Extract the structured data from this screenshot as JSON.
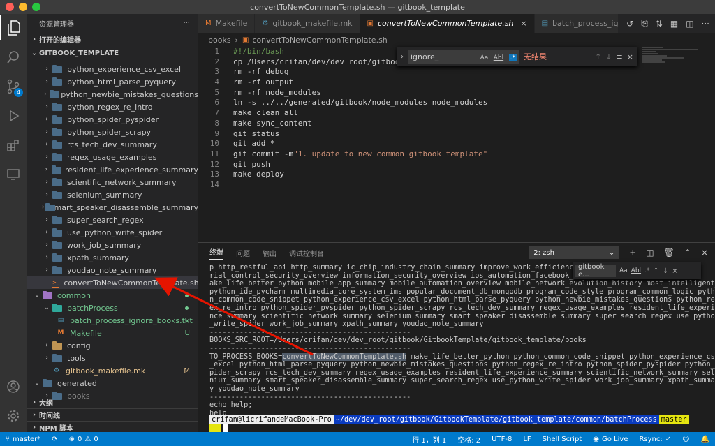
{
  "window": {
    "title": "convertToNewCommonTemplate.sh — gitbook_template"
  },
  "activity_bar": {
    "scm_badge": "4"
  },
  "sidebar": {
    "header": "资源管理器",
    "more": "···",
    "open_editors": "打开的编辑器",
    "workspace": "GITBOOK_TEMPLATE",
    "items": [
      {
        "label": "python_experience_csv_excel"
      },
      {
        "label": "python_html_parse_pyquery"
      },
      {
        "label": "python_newbie_mistakes_questions"
      },
      {
        "label": "python_regex_re_intro"
      },
      {
        "label": "python_spider_pyspider"
      },
      {
        "label": "python_spider_scrapy"
      },
      {
        "label": "rcs_tech_dev_summary"
      },
      {
        "label": "regex_usage_examples"
      },
      {
        "label": "resident_life_experience_summary"
      },
      {
        "label": "scientific_network_summary"
      },
      {
        "label": "selenium_summary"
      },
      {
        "label": "smart_speaker_disassemble_summary"
      },
      {
        "label": "super_search_regex"
      },
      {
        "label": "use_python_write_spider"
      },
      {
        "label": "work_job_summary"
      },
      {
        "label": "xpath_summary"
      },
      {
        "label": "youdao_note_summary"
      }
    ],
    "selected_file": "convertToNewCommonTemplate.sh",
    "common": "common",
    "batchProcess": "batchProcess",
    "batch_file": "batch_process_ignore_books.txt",
    "batch_status": "U",
    "makefile": "Makefile",
    "makefile_status": "U",
    "config": "config",
    "tools": "tools",
    "gitbook_makefile": "gitbook_makefile.mk",
    "gitbook_makefile_status": "M",
    "generated": "generated",
    "books": "books",
    "outline": "大纲",
    "timeline": "时间线",
    "npm": "NPM 脚本"
  },
  "tabs": [
    {
      "label": "Makefile",
      "icon": "makefile-icon",
      "color": "#e37933"
    },
    {
      "label": "gitbook_makefile.mk",
      "icon": "gear-icon",
      "color": "#519aba"
    },
    {
      "label": "convertToNewCommonTemplate.sh",
      "icon": "terminal-icon",
      "color": "#e37933",
      "active": true
    },
    {
      "label": "batch_process_ignc",
      "icon": "file-icon",
      "color": "#519aba"
    }
  ],
  "breadcrumb": {
    "folder": "books",
    "file": "convertToNewCommonTemplate.sh"
  },
  "code_lines": [
    "#!/bin/bash",
    "cp /Users/crifan/dev/dev_root/gitbook/g",
    "rm -rf debug",
    "rm -rf output",
    "rm -rf node_modules",
    "ln -s ../../generated/gitbook/node_modules node_modules",
    "make clean_all",
    "make sync_content",
    "git status",
    "git add *",
    "git commit -m ",
    "git push",
    "make deploy",
    ""
  ],
  "commit_message": "\"1. update to new common gitbook template\"",
  "find": {
    "value": "ignore_",
    "opt_case": "Aa",
    "opt_word": "Abl",
    "opt_regex": ".*",
    "result": "无结果"
  },
  "panel": {
    "tabs": [
      "终端",
      "问题",
      "输出",
      "调试控制台"
    ],
    "terminal_select": "2: zsh"
  },
  "terminal_find": {
    "value": "gitbook e...",
    "opt_case": "Aa",
    "opt_word": "Abl",
    "opt_regex": ".*"
  },
  "terminal": {
    "lines": [
      "p http_restful_api http_summary ic_chip_industry_chain_summary improve_work_efficiency i",
      "rial_control_security_overview information_security_overview ios_automation_facebook_wda",
      "ake_life_better_python mobile_app_summary mobile_automation_overview mobile_network_evolution_history most_intelligent_",
      "python_ide_pycharm multimedia_core_system_ims popular_document_db_mongodb program_code_style program_common_logic pytho",
      "n_common_code_snippet python_experience_csv_excel python_html_parse_pyquery python_newbie_mistakes_questions python_reg",
      "ex_re_intro python_spider_pyspider python_spider_scrapy rcs_tech_dev_summary regex_usage_examples resident_life_experie",
      "nce_summary scientific_network_summary selenium_summary smart_speaker_disassemble_summary super_search_regex use_python",
      "_write_spider work_job_summary xpath_summary youdao_note_summary",
      "-----------------------------------------------",
      "BOOKS_SRC_ROOT=/Users/crifan/dev/dev_root/gitbook/GitbookTemplate/gitbook_template/books",
      "-----------------------------------------------",
      "TO_PROCESS_BOOKS=",
      "_excel python_html_parse_pyquery python_newbie_mistakes_questions python_regex_re_intro python_spider_pyspider python_s",
      "pider_scrapy rcs_tech_dev_summary regex_usage_examples resident_life_experience_summary scientific_network_summary sele",
      "nium_summary smart_speaker_disassemble_summary super_search_regex use_python_write_spider work_job_summary xpath_summar",
      "y youdao_note_summary",
      "-----------------------------------------------",
      "echo help;",
      "help"
    ],
    "highlight_word": "convertToNewCommonTemplate.sh",
    "after_highlight": " make_life_better_python python_common_code_snippet python_experience_csv",
    "prompt_user": " crifan@licrifandeMacBook-Pro ",
    "prompt_path": " ~/dev/dev_root/gitbook/GitbookTemplate/gitbook_template/common/batchProcess ",
    "prompt_branch": " master "
  },
  "statusbar": {
    "branch": "master*",
    "sync": "⟳",
    "errors": "0",
    "warnings": "0",
    "position": "行 1，列 1",
    "spaces": "空格: 2",
    "encoding": "UTF-8",
    "eol": "LF",
    "language": "Shell Script",
    "golive": "Go Live",
    "rsync": "Rsync:"
  },
  "colors": {
    "accent": "#007acc",
    "selected_bg": "#37373d",
    "untracked": "#73c991",
    "modified": "#e2c08d",
    "arrow": "#e51400"
  }
}
